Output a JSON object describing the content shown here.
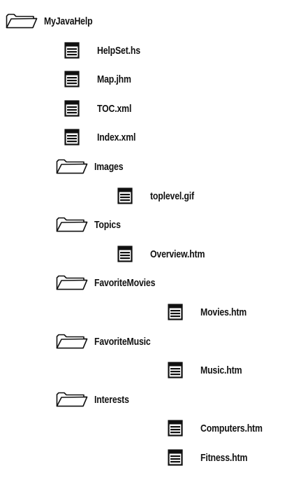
{
  "tree": [
    {
      "type": "folder",
      "icon": "folder-icon",
      "label": "MyJavaHelp",
      "depth": 0
    },
    {
      "type": "file",
      "icon": "document-icon",
      "label": "HelpSet.hs",
      "depth": 1
    },
    {
      "type": "file",
      "icon": "document-icon",
      "label": "Map.jhm",
      "depth": 1
    },
    {
      "type": "file",
      "icon": "document-icon",
      "label": "TOC.xml",
      "depth": 1
    },
    {
      "type": "file",
      "icon": "document-icon",
      "label": "Index.xml",
      "depth": 1
    },
    {
      "type": "folder",
      "icon": "folder-icon",
      "label": "Images",
      "depth": 1
    },
    {
      "type": "file",
      "icon": "document-icon",
      "label": "toplevel.gif",
      "depth": 2
    },
    {
      "type": "folder",
      "icon": "folder-icon",
      "label": "Topics",
      "depth": 1
    },
    {
      "type": "file",
      "icon": "document-icon",
      "label": "Overview.htm",
      "depth": 2
    },
    {
      "type": "folder",
      "icon": "folder-icon",
      "label": "FavoriteMovies",
      "depth": 2
    },
    {
      "type": "file",
      "icon": "document-icon",
      "label": "Movies.htm",
      "depth": 3
    },
    {
      "type": "folder",
      "icon": "folder-icon",
      "label": "FavoriteMusic",
      "depth": 2
    },
    {
      "type": "file",
      "icon": "document-icon",
      "label": "Music.htm",
      "depth": 3
    },
    {
      "type": "folder",
      "icon": "folder-icon",
      "label": "Interests",
      "depth": 2
    },
    {
      "type": "file",
      "icon": "document-icon",
      "label": "Computers.htm",
      "depth": 3
    },
    {
      "type": "file",
      "icon": "document-icon",
      "label": "Fitness.htm",
      "depth": 3
    }
  ]
}
